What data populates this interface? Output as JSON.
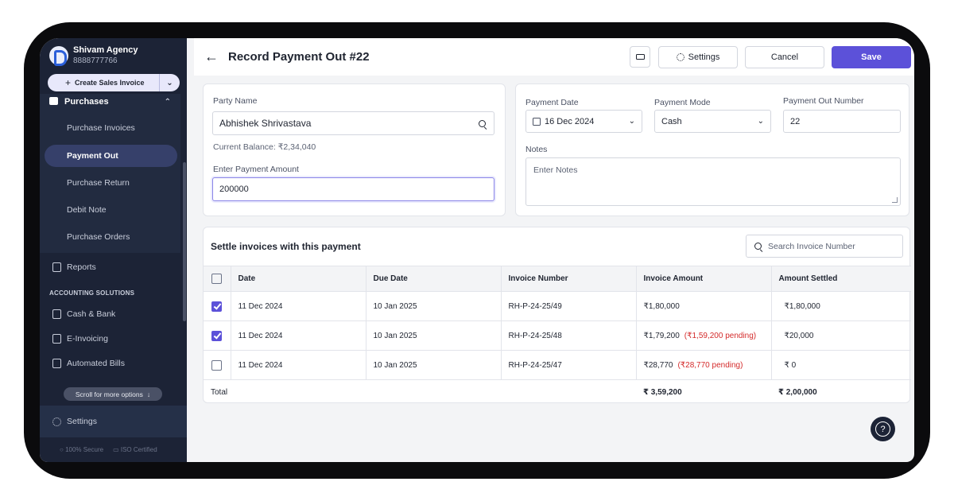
{
  "company": {
    "name": "Shivam Agency",
    "phone": "8888777766"
  },
  "sidebar": {
    "create_button": "Create Sales Invoice",
    "group_title": "Purchases",
    "group_items": [
      {
        "label": "Purchase Invoices"
      },
      {
        "label": "Payment Out",
        "active": true
      },
      {
        "label": "Purchase Return"
      },
      {
        "label": "Debit Note"
      },
      {
        "label": "Purchase Orders"
      }
    ],
    "reports": "Reports",
    "section_title": "ACCOUNTING SOLUTIONS",
    "accounting_items": [
      {
        "label": "Cash & Bank",
        "icon": "bank-icon"
      },
      {
        "label": "E-Invoicing",
        "icon": "e-invoice-icon"
      },
      {
        "label": "Automated Bills",
        "icon": "automated-bills-icon"
      }
    ],
    "scroll_hint": "Scroll for more options",
    "settings": "Settings",
    "badge_secure": "100% Secure",
    "badge_iso": "ISO Certified"
  },
  "header": {
    "title": "Record Payment Out #22",
    "settings_label": "Settings",
    "cancel_label": "Cancel",
    "save_label": "Save"
  },
  "form": {
    "party_label": "Party Name",
    "party_value": "Abhishek Shrivastava",
    "current_balance": "Current Balance: ₹2,34,040",
    "amount_label": "Enter Payment Amount",
    "amount_value": "200000",
    "date_label": "Payment Date",
    "date_value": "16 Dec 2024",
    "mode_label": "Payment Mode",
    "mode_value": "Cash",
    "number_label": "Payment Out Number",
    "number_value": "22",
    "notes_label": "Notes",
    "notes_placeholder": "Enter Notes"
  },
  "settle": {
    "title": "Settle invoices with this payment",
    "search_placeholder": "Search Invoice Number",
    "columns": [
      "Date",
      "Due Date",
      "Invoice Number",
      "Invoice Amount",
      "Amount Settled"
    ],
    "rows": [
      {
        "checked": true,
        "date": "11 Dec 2024",
        "due": "10 Jan 2025",
        "invoice": "RH-P-24-25/49",
        "amount": "₹1,80,000",
        "pending": "",
        "settled": "₹1,80,000"
      },
      {
        "checked": true,
        "date": "11 Dec 2024",
        "due": "10 Jan 2025",
        "invoice": "RH-P-24-25/48",
        "amount": "₹1,79,200",
        "pending": "(₹1,59,200 pending)",
        "settled": "₹20,000"
      },
      {
        "checked": false,
        "date": "11 Dec 2024",
        "due": "10 Jan 2025",
        "invoice": "RH-P-24-25/47",
        "amount": "₹28,770",
        "pending": "(₹28,770 pending)",
        "settled": "₹ 0"
      }
    ],
    "total_label": "Total",
    "total_amount": "₹ 3,59,200",
    "total_settled": "₹ 2,00,000"
  },
  "colors": {
    "accent": "#5c51d9",
    "sidebar": "#1c2336",
    "pending": "#d42b2b"
  }
}
